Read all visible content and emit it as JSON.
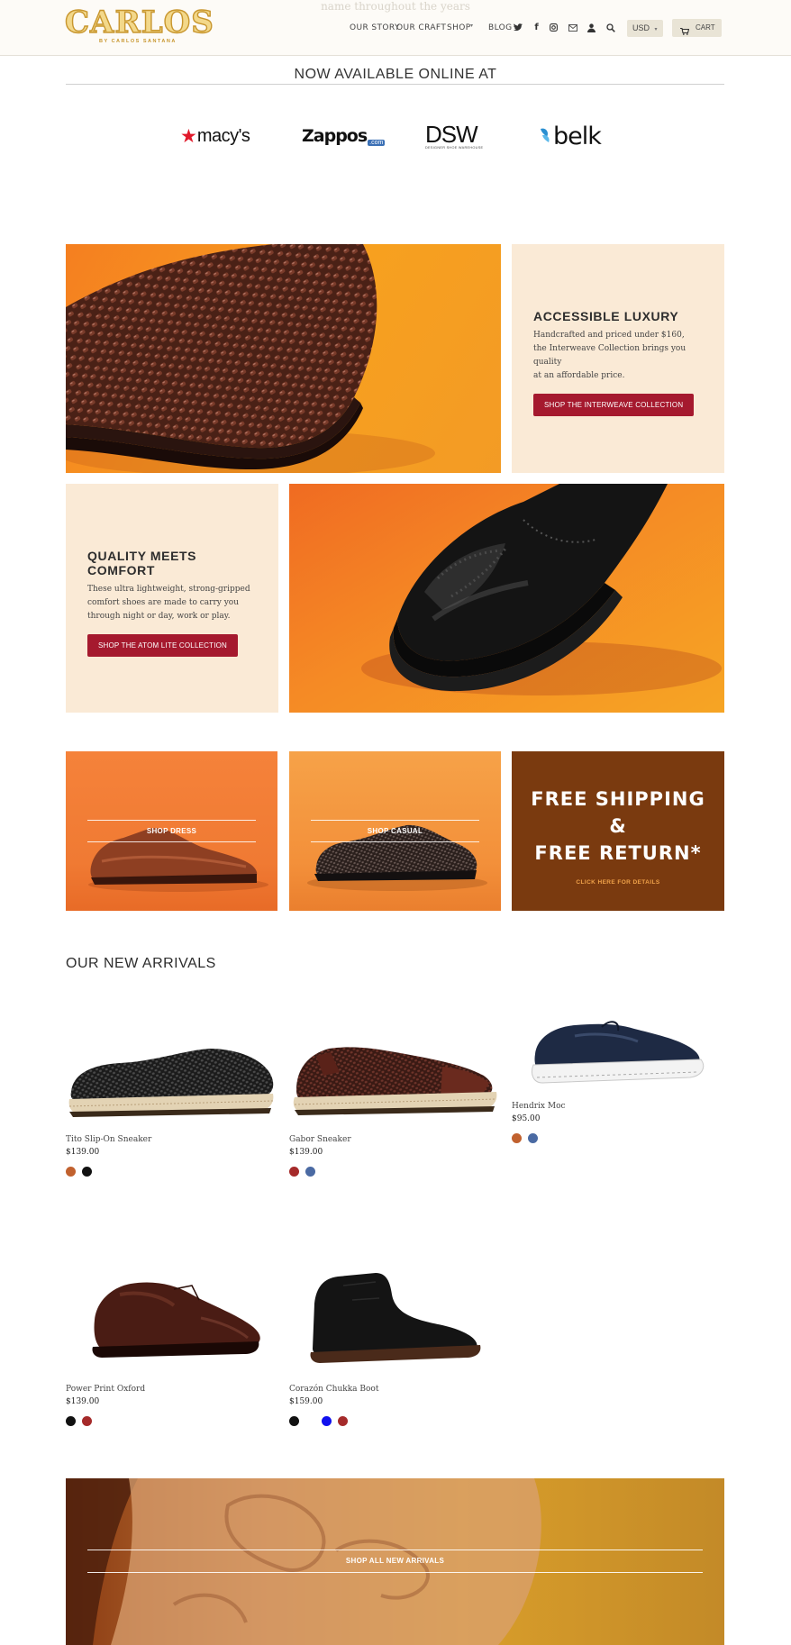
{
  "header": {
    "faded_text": "name throughout the years",
    "logo_text": "CARLOS",
    "logo_sub": "BY CARLOS SANTANA",
    "nav": [
      "OUR STORY",
      "OUR CRAFT",
      "SHOP",
      "BLOG"
    ],
    "icons": [
      "twitter-icon",
      "facebook-icon",
      "instagram-icon",
      "mail-icon",
      "account-icon",
      "search-icon"
    ],
    "currency": "USD",
    "cart_label": "CART"
  },
  "retailers": {
    "title": "NOW AVAILABLE ONLINE AT",
    "logos": [
      "macy's",
      "Zappos",
      ".com",
      "DSW",
      "DESIGNER SHOE WAREHOUSE",
      "belk"
    ]
  },
  "promos": [
    {
      "title": "ACCESSIBLE LUXURY",
      "line1": "Handcrafted and priced under $160,",
      "line2": "the Interweave Collection brings you quality",
      "line3": "at an affordable price.",
      "button": "SHOP THE INTERWEAVE COLLECTION"
    },
    {
      "title": "QUALITY MEETS COMFORT",
      "line1": "These ultra lightweight, strong-gripped",
      "line2": "comfort shoes are made to carry you",
      "line3": "through night or day, work or play.",
      "button": "SHOP THE ATOM LITE COLLECTION"
    }
  ],
  "categories": {
    "dress": "SHOP DRESS",
    "casual": "SHOP CASUAL",
    "shipping_line1": "FREE SHIPPING",
    "shipping_line2": "&",
    "shipping_line3": "FREE RETURN*",
    "shipping_details": "CLICK HERE FOR DETAILS"
  },
  "arrivals": {
    "title": "OUR NEW ARRIVALS",
    "products": [
      {
        "name": "Tito Slip-On Sneaker",
        "price": "$139.00",
        "swatches": [
          "#c1612e",
          "#111111"
        ]
      },
      {
        "name": "Gabor Sneaker",
        "price": "$139.00",
        "swatches": [
          "#a52a2a",
          "#4a6aa3"
        ]
      },
      {
        "name": "Hendrix Moc",
        "price": "$95.00",
        "swatches": [
          "#c1612e",
          "#4a6aa3"
        ]
      },
      {
        "name": "Power Print Oxford",
        "price": "$139.00",
        "swatches": [
          "#111111",
          "#a52a2a"
        ]
      },
      {
        "name": "Corazón Chukka Boot",
        "price": "$159.00",
        "swatches": [
          "#111111",
          "#ffffff",
          "#1010ee",
          "#a52a2a"
        ]
      }
    ]
  },
  "banner": {
    "label": "SHOP ALL NEW ARRIVALS"
  },
  "colors": {
    "accent_red": "#a5192e",
    "cream": "#faead6",
    "brown": "#7a3a0f",
    "orange": "#f29a28"
  }
}
